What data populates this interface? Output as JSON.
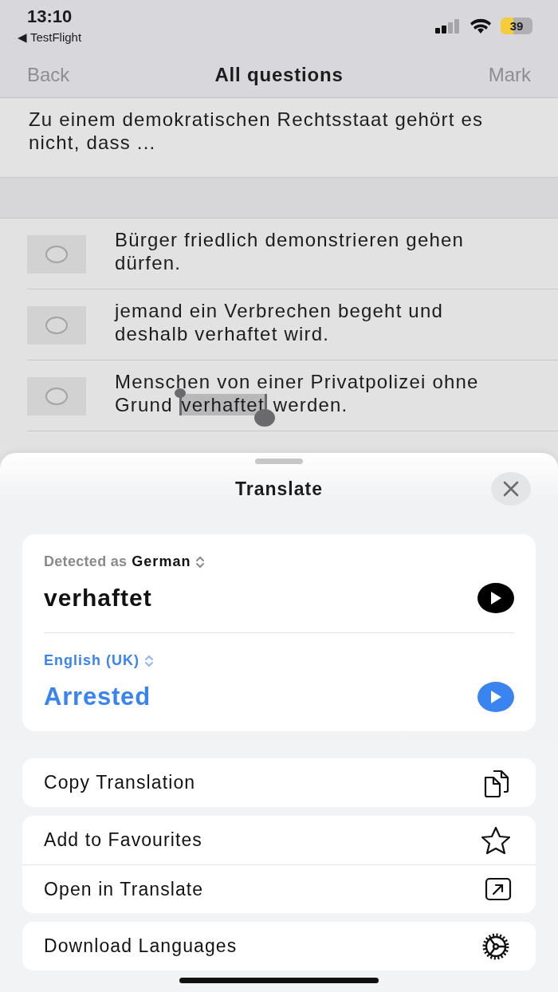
{
  "status_bar": {
    "time": "13:10",
    "back_app": "◀ TestFlight",
    "battery": "39"
  },
  "nav": {
    "back": "Back",
    "title": "All questions",
    "action": "Mark"
  },
  "question": "Zu einem demokratischen Rechtsstaat gehört es nicht, dass ...",
  "answers": [
    {
      "selected": false,
      "text": "Bürger friedlich demonstrieren gehen dürfen."
    },
    {
      "selected": false,
      "text": "jemand ein Verbrechen begeht und deshalb verhaftet wird."
    },
    {
      "selected": false,
      "segments": [
        {
          "text": "Menschen von einer Privatpolizei ohne Grund ",
          "selected": false
        },
        {
          "text": "verhaftet",
          "selected": true
        },
        {
          "text": " werden.",
          "selected": false
        }
      ]
    }
  ],
  "translate": {
    "title": "Translate",
    "source_prefix": "Detected as",
    "source_language": "German",
    "source_text": "verhaftet",
    "target_language": "English (UK)",
    "target_text": "Arrested",
    "action_groups": [
      [
        "Copy Translation"
      ],
      [
        "Add to Favourites",
        "Open in Translate"
      ],
      [
        "Download Languages"
      ]
    ]
  }
}
